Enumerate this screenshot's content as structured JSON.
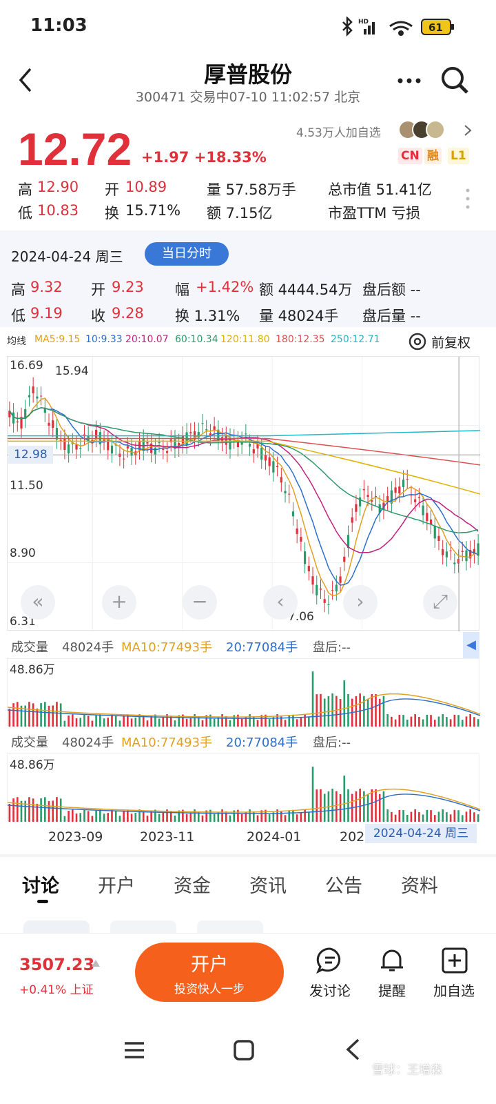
{
  "status": {
    "time": "11:03",
    "battery": "61"
  },
  "stock": {
    "name": "厚普股份",
    "subtitle": "300471 交易中07-10 11:02:57 北京",
    "price": "12.72",
    "change": "+1.97 +18.33%",
    "followers": "4.53万人加自选",
    "tags": [
      "CN",
      "融",
      "L1"
    ]
  },
  "quote": {
    "high_label": "高",
    "high": "12.90",
    "low_label": "低",
    "low": "10.83",
    "open_label": "开",
    "open": "10.89",
    "turnover_label": "换",
    "turnover": "15.71%",
    "volume": "量 57.58万手",
    "amount": "额 7.15亿",
    "mktcap": "总市值 51.41亿",
    "pe": "市盈TTM 亏损"
  },
  "day": {
    "date": "2024-04-24 周三",
    "button": "当日分时",
    "high_label": "高",
    "high": "9.32",
    "open_label": "开",
    "open": "9.23",
    "range_label": "幅",
    "range": "+1.42%",
    "amount": "额 4444.54万",
    "after_amount": "盘后额 --",
    "low_label": "低",
    "low": "9.19",
    "close_label": "收",
    "close": "9.28",
    "turnover": "换 1.31%",
    "volume": "量 48024手",
    "after_volume": "盘后量 --"
  },
  "ma": {
    "label": "均线",
    "items": [
      {
        "text": "MA5:9.15",
        "color": "#e0a020"
      },
      {
        "text": "10:9.33",
        "color": "#2b6fc9"
      },
      {
        "text": "20:10.07",
        "color": "#c02080"
      },
      {
        "text": "60:10.34",
        "color": "#2a9a6a"
      },
      {
        "text": "120:11.80",
        "color": "#e0b000"
      },
      {
        "text": "180:12.35",
        "color": "#e05050"
      },
      {
        "text": "250:12.71",
        "color": "#20b8c8"
      }
    ],
    "adjust": "前复权"
  },
  "chart": {
    "y_labels": [
      "16.69",
      "11.50",
      "8.90",
      "6.31"
    ],
    "top_marker": "15.94",
    "low_marker": "7.06",
    "crosshair_price": "12.98",
    "controls": [
      "«",
      "+",
      "−",
      "‹",
      "›",
      "⤢"
    ]
  },
  "volume": {
    "label": "成交量",
    "value": "48024手",
    "ma10": "MA10:77493手",
    "ma20": "20:77084手",
    "after": "盘后:--",
    "max": "48.86万"
  },
  "x_axis": {
    "labels": [
      "2023-09",
      "2023-11",
      "2024-01",
      "202"
    ],
    "cursor_date": "2024-04-24 周三"
  },
  "tabs": [
    "讨论",
    "开户",
    "资金",
    "资讯",
    "公告",
    "资料"
  ],
  "bottom": {
    "index_value": "3507.23",
    "index_change": "+0.41% 上证",
    "open_title": "开户",
    "open_sub": "投资快人一步",
    "actions": [
      "发讨论",
      "提醒",
      "加自选"
    ]
  },
  "watermark": "雪球：王增森",
  "colors": {
    "up": "#e0303a",
    "down": "#2a9a6a",
    "accent": "#f5601d"
  }
}
